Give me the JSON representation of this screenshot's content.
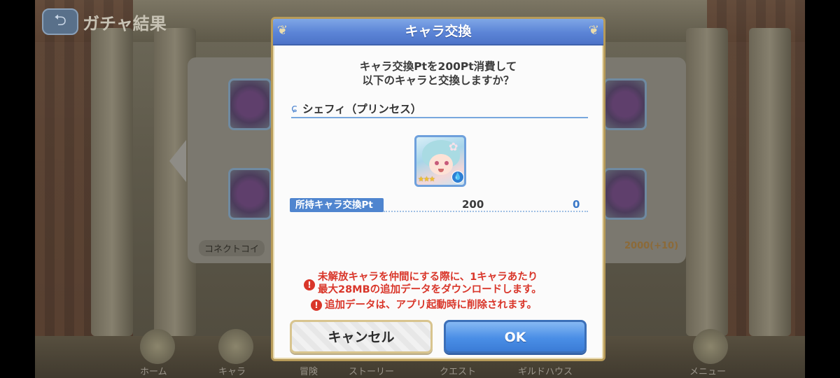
{
  "background": {
    "screen_title": "ガチャ結果",
    "back_icon": "back-arrow-icon",
    "connect_label": "コネクトコイ",
    "pt_right": "2000(+10)",
    "nav_items": [
      "ホーム",
      "キャラ",
      "冒険",
      "ストーリー",
      "クエスト",
      "ギルドハウス",
      "メニュー"
    ]
  },
  "dialog": {
    "title": "キャラ交換",
    "message_line1": "キャラ交換Ptを200Pt消費して",
    "message_line2": "以下のキャラと交換しますか？",
    "character_name": "シェフィ（プリンセス）",
    "star_rating": 3,
    "element_icon": "water-drop-icon",
    "pt_label": "所持キャラ交換Pt",
    "pt_current": "200",
    "pt_after": "0",
    "warning1_line1": "未解放キャラを仲間にする際に、1キャラあたり",
    "warning1_line2": "最大28MBの追加データをダウンロードします。",
    "warning2": "追加データは、アプリ起動時に削除されます。",
    "warning_icon": "!",
    "cancel_label": "キャンセル",
    "ok_label": "OK"
  },
  "colors": {
    "header_blue": "#5b84d6",
    "warning_red": "#d9362a",
    "ok_blue": "#4a8ee6",
    "gold_border": "#b79b59"
  }
}
